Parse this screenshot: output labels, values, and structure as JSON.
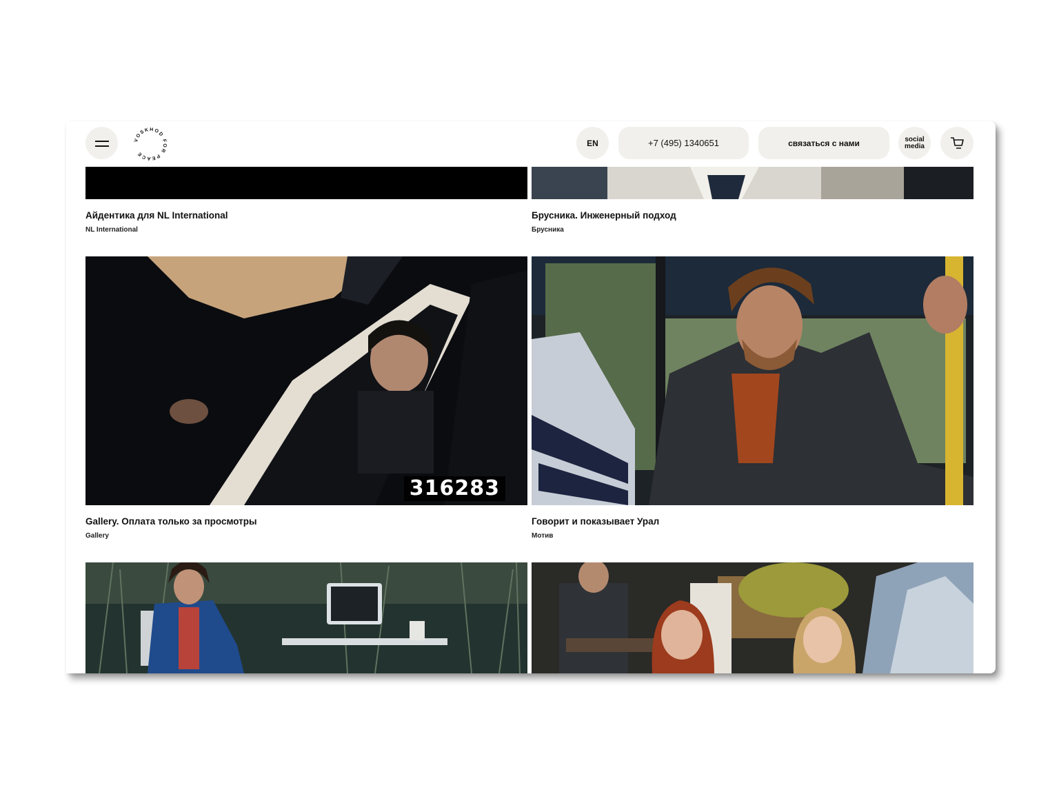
{
  "header": {
    "lang_label": "EN",
    "phone": "+7 (495) 1340651",
    "contact_label": "связаться с нами",
    "social_line1": "social",
    "social_line2": "media",
    "logo_text": "VOSKHOD FOR PEACE"
  },
  "projects": [
    {
      "title": "Айдентика для NL International",
      "client": "NL International"
    },
    {
      "title": "Брусника. Инженерный подход",
      "client": "Брусника"
    },
    {
      "title": "Gallery. Оплата только за просмотры",
      "client": "Gallery",
      "counter": "316283"
    },
    {
      "title": "Говорит и показывает Урал",
      "client": "Мотив"
    },
    {
      "title": "",
      "client": ""
    },
    {
      "title": "",
      "client": ""
    }
  ],
  "colors": {
    "pill_bg": "#f1f0ec",
    "text": "#111111"
  }
}
